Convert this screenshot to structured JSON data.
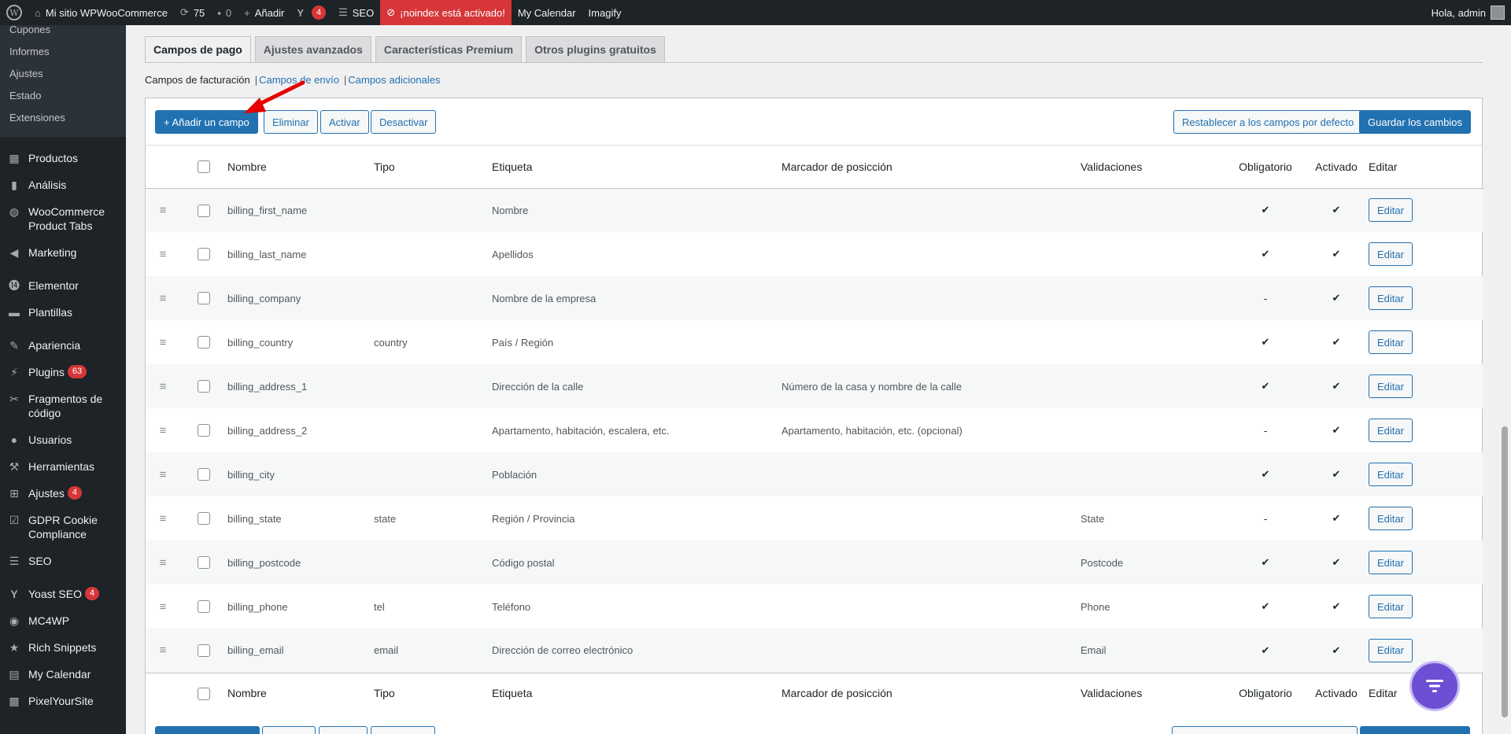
{
  "adminbar": {
    "site_name": "Mi sitio WPWooCommerce",
    "updates_count": "75",
    "comments_count": "0",
    "add_label": "Añadir",
    "yoast_count": "4",
    "seo_label": "SEO",
    "noindex_label": "¡noindex está activado!",
    "calendar_label": "My Calendar",
    "imagify_label": "Imagify",
    "greeting": "Hola, admin"
  },
  "sidebar": {
    "submenu": [
      "Cupones",
      "Informes",
      "Ajustes",
      "Estado",
      "Extensiones"
    ],
    "items": [
      {
        "label": "Productos",
        "icon": "archive-icon"
      },
      {
        "label": "Análisis",
        "icon": "bar-chart-icon"
      },
      {
        "label": "WooCommerce Product Tabs",
        "icon": "globe-icon"
      },
      {
        "label": "Marketing",
        "icon": "megaphone-icon"
      },
      {
        "label": "Elementor",
        "icon": "elementor-icon"
      },
      {
        "label": "Plantillas",
        "icon": "folder-icon"
      },
      {
        "label": "Apariencia",
        "icon": "brush-icon"
      },
      {
        "label": "Plugins",
        "icon": "plug-icon",
        "badge": "63"
      },
      {
        "label": "Fragmentos de código",
        "icon": "scissors-icon"
      },
      {
        "label": "Usuarios",
        "icon": "user-icon"
      },
      {
        "label": "Herramientas",
        "icon": "wrench-icon"
      },
      {
        "label": "Ajustes",
        "icon": "settings-icon",
        "badge": "4"
      },
      {
        "label": "GDPR Cookie Compliance",
        "icon": "check-square-icon"
      },
      {
        "label": "SEO",
        "icon": "seo-icon"
      },
      {
        "label": "Yoast SEO",
        "icon": "yoast-icon",
        "badge": "4"
      },
      {
        "label": "MC4WP",
        "icon": "mc4wp-icon"
      },
      {
        "label": "Rich Snippets",
        "icon": "star-icon"
      },
      {
        "label": "My Calendar",
        "icon": "calendar-icon"
      },
      {
        "label": "PixelYourSite",
        "icon": "pixel-icon"
      }
    ]
  },
  "tabs": [
    "Campos de pago",
    "Ajustes avanzados",
    "Características Premium",
    "Otros plugins gratuitos"
  ],
  "subsub": {
    "current": "Campos de facturación",
    "link1": "Campos de envío",
    "link2": "Campos adicionales",
    "sep": "|"
  },
  "toolbar": {
    "add": "+ Añadir un campo",
    "delete": "Eliminar",
    "activate": "Activar",
    "deactivate": "Desactivar",
    "reset": "Restablecer a los campos por defecto",
    "save": "Guardar los cambios"
  },
  "columns": {
    "name": "Nombre",
    "type": "Tipo",
    "label": "Etiqueta",
    "placeholder": "Marcador de posicción",
    "validations": "Validaciones",
    "required": "Obligatorio",
    "enabled": "Activado",
    "edit": "Editar"
  },
  "rows": [
    {
      "name": "billing_first_name",
      "type": "",
      "label": "Nombre",
      "placeholder": "",
      "validation": "",
      "required": "✔",
      "enabled": "✔",
      "edit": "Editar"
    },
    {
      "name": "billing_last_name",
      "type": "",
      "label": "Apellidos",
      "placeholder": "",
      "validation": "",
      "required": "✔",
      "enabled": "✔",
      "edit": "Editar"
    },
    {
      "name": "billing_company",
      "type": "",
      "label": "Nombre de la empresa",
      "placeholder": "",
      "validation": "",
      "required": "-",
      "enabled": "✔",
      "edit": "Editar"
    },
    {
      "name": "billing_country",
      "type": "country",
      "label": "País / Región",
      "placeholder": "",
      "validation": "",
      "required": "✔",
      "enabled": "✔",
      "edit": "Editar"
    },
    {
      "name": "billing_address_1",
      "type": "",
      "label": "Dirección de la calle",
      "placeholder": "Número de la casa y nombre de la calle",
      "validation": "",
      "required": "✔",
      "enabled": "✔",
      "edit": "Editar"
    },
    {
      "name": "billing_address_2",
      "type": "",
      "label": "Apartamento, habitación, escalera, etc.",
      "placeholder": "Apartamento, habitación, etc. (opcional)",
      "validation": "",
      "required": "-",
      "enabled": "✔",
      "edit": "Editar"
    },
    {
      "name": "billing_city",
      "type": "",
      "label": "Población",
      "placeholder": "",
      "validation": "",
      "required": "✔",
      "enabled": "✔",
      "edit": "Editar"
    },
    {
      "name": "billing_state",
      "type": "state",
      "label": "Región / Provincia",
      "placeholder": "",
      "validation": "State",
      "required": "-",
      "enabled": "✔",
      "edit": "Editar"
    },
    {
      "name": "billing_postcode",
      "type": "",
      "label": "Código postal",
      "placeholder": "",
      "validation": "Postcode",
      "required": "✔",
      "enabled": "✔",
      "edit": "Editar"
    },
    {
      "name": "billing_phone",
      "type": "tel",
      "label": "Teléfono",
      "placeholder": "",
      "validation": "Phone",
      "required": "✔",
      "enabled": "✔",
      "edit": "Editar"
    },
    {
      "name": "billing_email",
      "type": "email",
      "label": "Dirección de correo electrónico",
      "placeholder": "",
      "validation": "Email",
      "required": "✔",
      "enabled": "✔",
      "edit": "Editar"
    }
  ],
  "colors": {
    "accent": "#2271b1",
    "adminbar": "#1d2327",
    "badge": "#d63638",
    "fab": "#6d4fd3",
    "annotation": "#e60000"
  }
}
